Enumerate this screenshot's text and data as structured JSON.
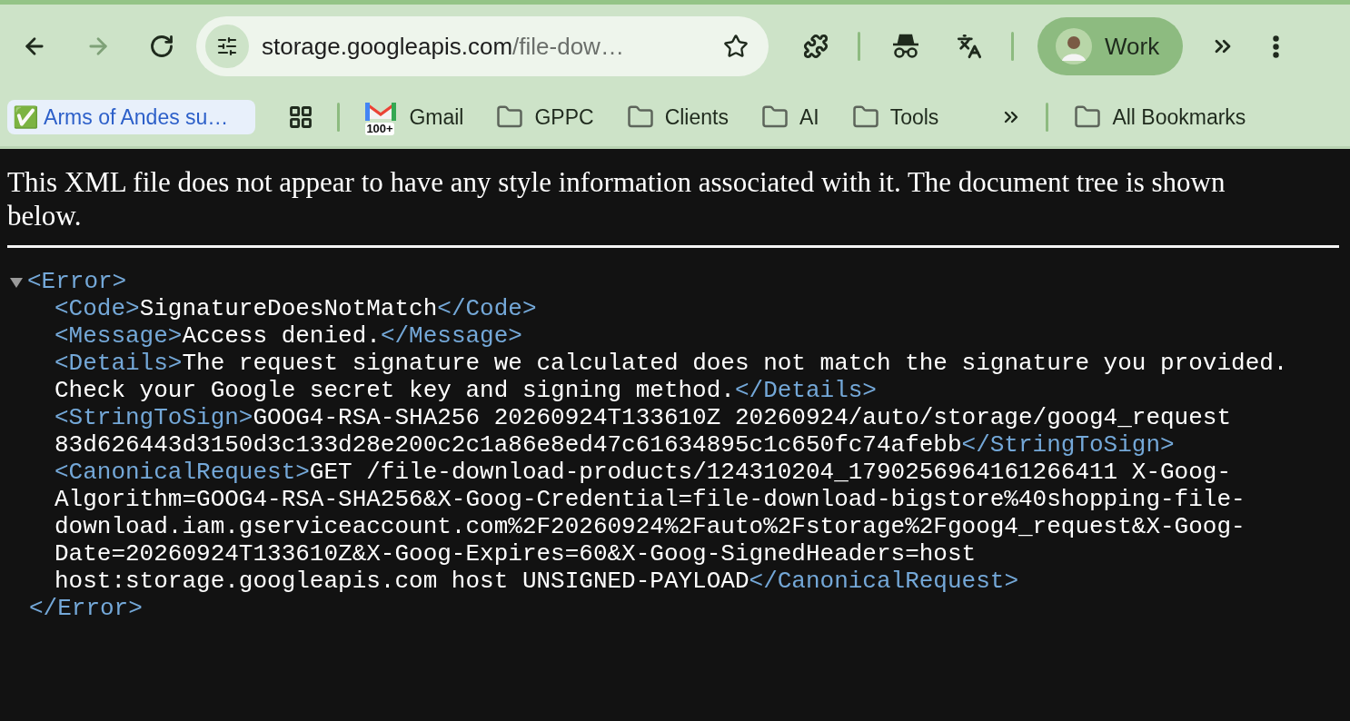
{
  "toolbar": {
    "back": {
      "disabled": false
    },
    "forward": {
      "disabled": true
    },
    "address": {
      "host": "storage.googleapis.com",
      "path": "/file-dow…"
    },
    "profile": {
      "label": "Work"
    }
  },
  "bookmarks": {
    "pinned": {
      "label": "✅ Arms of Andes su…"
    },
    "items": [
      {
        "kind": "gmail",
        "label": "Gmail",
        "badge": "100+"
      },
      {
        "kind": "folder",
        "label": "GPPC"
      },
      {
        "kind": "folder",
        "label": "Clients"
      },
      {
        "kind": "folder",
        "label": "AI"
      },
      {
        "kind": "folder",
        "label": "Tools"
      }
    ],
    "all": {
      "label": "All Bookmarks"
    }
  },
  "page": {
    "notice": "This XML file does not appear to have any style information associated with it. The document tree is shown below.",
    "root": {
      "open": "<Error>",
      "close": "</Error>",
      "expanded": true,
      "children": [
        {
          "open": "<Code>",
          "lines": [
            "SignatureDoesNotMatch"
          ],
          "close": "</Code>"
        },
        {
          "open": "<Message>",
          "lines": [
            "Access denied."
          ],
          "close": "</Message>"
        },
        {
          "open": "<Details>",
          "lines": [
            "The request signature we calculated does not match the signature you provided.",
            "Check your Google secret key and signing method."
          ],
          "close": "</Details>"
        },
        {
          "open": "<StringToSign>",
          "lines": [
            "GOOG4-RSA-SHA256 20260924T133610Z 20260924/auto/storage/goog4_request",
            "83d626443d3150d3c133d28e200c2c1a86e8ed47c61634895c1c650fc74afebb"
          ],
          "close": "</StringToSign>"
        },
        {
          "open": "<CanonicalRequest>",
          "lines": [
            "GET /file-download-products/124310204_1790256964161266411 X-Goog-",
            "Algorithm=GOOG4-RSA-SHA256&X-Goog-Credential=file-download-bigstore%40shopping-file-",
            "download.iam.gserviceaccount.com%2F20260924%2Fauto%2Fstorage%2Fgoog4_request&X-Goog-",
            "Date=20260924T133610Z&X-Goog-Expires=60&X-Goog-SignedHeaders=host",
            "host:storage.googleapis.com host UNSIGNED-PAYLOAD"
          ],
          "close": "</CanonicalRequest>"
        }
      ]
    }
  }
}
